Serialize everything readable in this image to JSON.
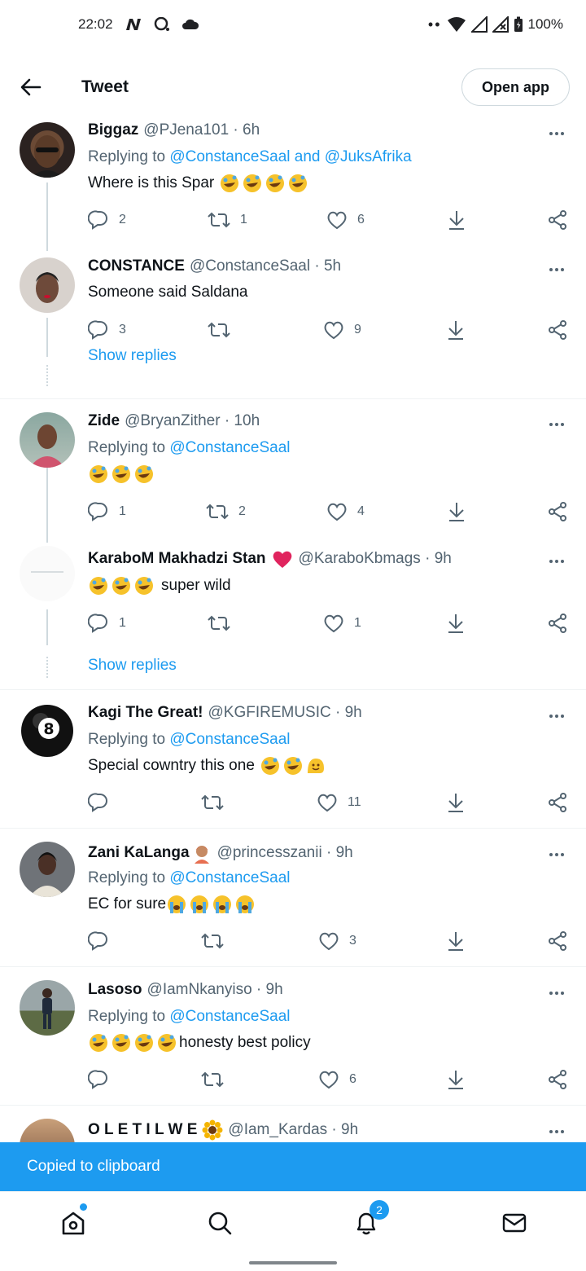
{
  "status_bar": {
    "time": "22:02",
    "battery": "100%"
  },
  "header": {
    "title": "Tweet",
    "open_app": "Open app"
  },
  "tweets": [
    {
      "name": "Biggaz",
      "handle": "@PJena101 · 6h",
      "reply_prefix": "Replying to ",
      "reply_to": "@ConstanceSaal and @JuksAfrika",
      "text": "Where is this Spar",
      "replies": "2",
      "retweets": "1",
      "likes": "6"
    },
    {
      "name": "CONSTANCE",
      "handle": "@ConstanceSaal · 5h",
      "text": "Someone said Saldana",
      "replies": "3",
      "retweets": "",
      "likes": "9",
      "show_replies": "Show replies"
    },
    {
      "name": "Zide",
      "handle": "@BryanZither · 10h",
      "reply_prefix": "Replying to ",
      "reply_to": "@ConstanceSaal",
      "text": "",
      "replies": "1",
      "retweets": "2",
      "likes": "4"
    },
    {
      "name": "KaraboM Makhadzi Stan",
      "handle": "@KaraboKbmags · 9h",
      "text": "super wild",
      "replies": "1",
      "retweets": "",
      "likes": "1",
      "show_replies": "Show replies"
    },
    {
      "name": "Kagi The Great!",
      "handle": "@KGFIREMUSIC · 9h",
      "reply_prefix": "Replying to ",
      "reply_to": "@ConstanceSaal",
      "text": "Special cowntry this one",
      "replies": "",
      "retweets": "",
      "likes": "11"
    },
    {
      "name": "Zani KaLanga",
      "handle": "@princesszanii · 9h",
      "reply_prefix": "Replying to ",
      "reply_to": "@ConstanceSaal",
      "text": "EC for sure",
      "replies": "",
      "retweets": "",
      "likes": "3"
    },
    {
      "name": "Lasoso",
      "handle": "@IamNkanyiso · 9h",
      "reply_prefix": "Replying to ",
      "reply_to": "@ConstanceSaal",
      "text": "honesty best policy",
      "replies": "",
      "retweets": "",
      "likes": "6"
    },
    {
      "name": "O L E T I L W E",
      "handle": "@Iam_Kardas · 9h"
    }
  ],
  "toast": "Copied to clipboard",
  "nav": {
    "notifications_badge": "2"
  },
  "colors": {
    "accent": "#1d9bf0",
    "text": "#0f1419",
    "secondary": "#536471",
    "heart": "#e0245e"
  }
}
